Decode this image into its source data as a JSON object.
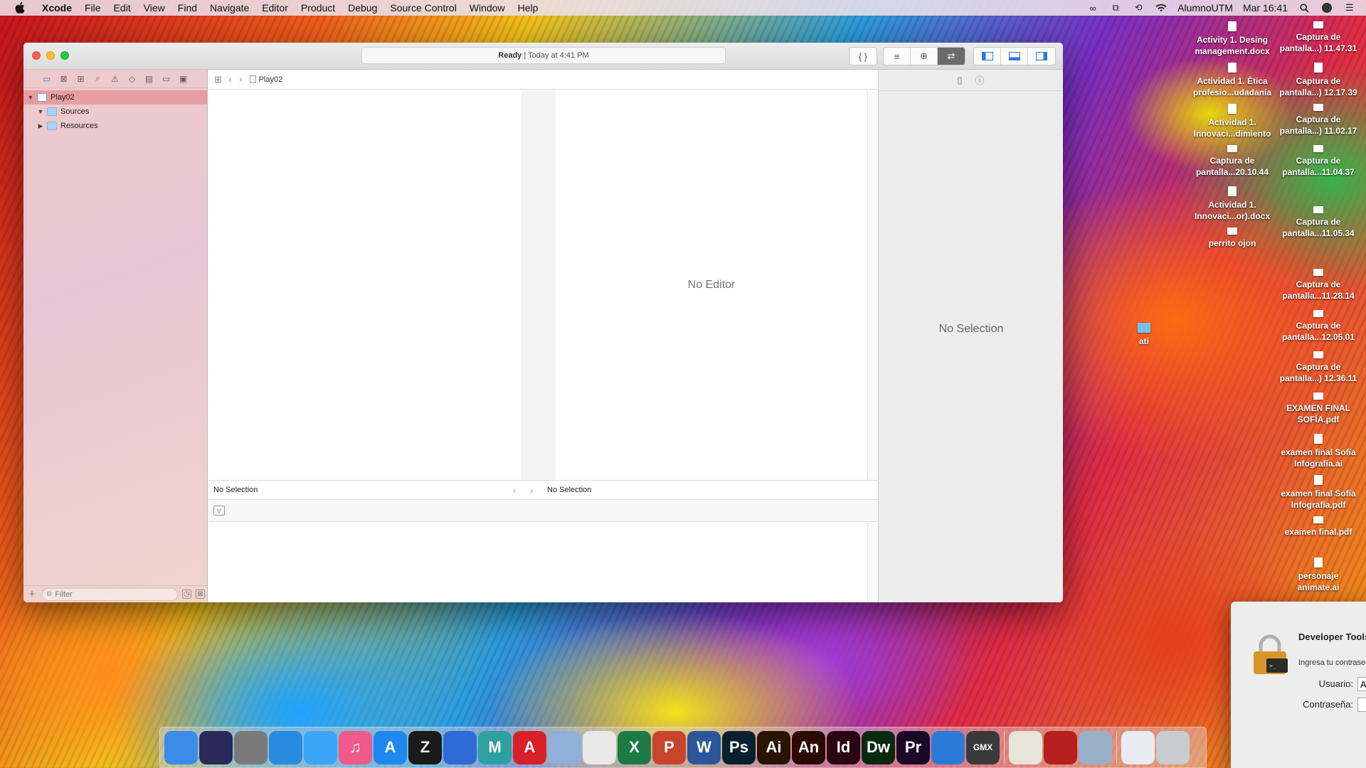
{
  "menubar": {
    "items": [
      "Xcode",
      "File",
      "Edit",
      "View",
      "Find",
      "Navigate",
      "Editor",
      "Product",
      "Debug",
      "Source Control",
      "Window",
      "Help"
    ],
    "user": "AlumnoUTM",
    "clock": "Mar 16:41"
  },
  "window": {
    "activity_status": "Ready",
    "activity_time": "Today at 4:41 PM",
    "toolbar": {
      "editor_buttons": [
        "{ }",
        "≡",
        "⊕",
        "⇄"
      ],
      "view_buttons": [
        "navigator-toggle",
        "debug-toggle",
        "inspector-toggle"
      ]
    },
    "navigator": {
      "items": [
        {
          "label": "Play02",
          "type": "doc",
          "level": 0,
          "expanded": true,
          "selected": true
        },
        {
          "label": "Sources",
          "type": "folder",
          "level": 1,
          "expanded": true,
          "selected": false
        },
        {
          "label": "Resources",
          "type": "folder",
          "level": 1,
          "expanded": false,
          "selected": false
        }
      ],
      "filter_placeholder": "Filter"
    },
    "jumpbar": {
      "crumb": "Play02"
    },
    "editor": {
      "empty_text": "No Editor"
    },
    "footer": {
      "left": "No Selection",
      "right": "No Selection"
    },
    "inspector": {
      "empty_text": "No Selection"
    }
  },
  "desktop": {
    "items": [
      "Activity 1. Desing management.docx",
      "Captura de pantalla...) 11.47.31",
      "Actividad 1. Ética profesio...udadanía",
      "Captura de pantalla...) 12.17.39",
      "Actividad 1. Innovaci...dimiento",
      "Captura de pantalla...) 11.02.17",
      "Captura de pantalla...20.10.44",
      "Captura de pantalla...11.04.37",
      "Actividad 1. Innovaci...or).docx",
      "Captura de pantalla...11.05.34",
      "perrito ojon",
      "Captura de pantalla...11.28.14",
      "ati",
      "Captura de pantalla...12.05.01",
      "Captura de pantalla...) 12.36.11",
      "EXAMEN FINAL SOFÍA.pdf",
      "examen final Sofía Infografía.ai",
      "examen final Sofía Infografía.pdf",
      "examen final.pdf",
      "personaje animate.ai"
    ]
  },
  "auth_dialog": {
    "title": "Developer Tools Access necesita el control de otro proceso",
    "subtitle": "Ingresa tu contraseña para permitirlo.",
    "user_label": "Usuario:",
    "user_value": "A",
    "password_label": "Contraseña:"
  },
  "dock": {
    "apps": [
      {
        "name": "Finder",
        "label": "",
        "color": "#3b8be8"
      },
      {
        "name": "Siri",
        "label": "",
        "color": "#2a2a5a"
      },
      {
        "name": "Launchpad",
        "label": "",
        "color": "#7a7a7a"
      },
      {
        "name": "Safari",
        "label": "",
        "color": "#2a8ae0"
      },
      {
        "name": "Messages",
        "label": "",
        "color": "#3aa6f5"
      },
      {
        "name": "iTunes",
        "label": "♫",
        "color": "#f05a8a"
      },
      {
        "name": "App Store",
        "label": "A",
        "color": "#1e88f0"
      },
      {
        "name": "Final Draft",
        "label": "Z",
        "color": "#1a1a1a"
      },
      {
        "name": "Network Radar",
        "label": "",
        "color": "#2e6ad8"
      },
      {
        "name": "Maya",
        "label": "M",
        "color": "#2ea0a0"
      },
      {
        "name": "Acrobat",
        "label": "A",
        "color": "#d8202a"
      },
      {
        "name": "Cube",
        "label": "",
        "color": "#8fb0d8"
      },
      {
        "name": "Chrome",
        "label": "",
        "color": "#e8e8e8"
      },
      {
        "name": "Excel",
        "label": "X",
        "color": "#1d7a45"
      },
      {
        "name": "PowerPoint",
        "label": "P",
        "color": "#c8452b"
      },
      {
        "name": "Word",
        "label": "W",
        "color": "#2b579a"
      },
      {
        "name": "Photoshop",
        "label": "Ps",
        "color": "#0a1f30"
      },
      {
        "name": "Illustrator",
        "label": "Ai",
        "color": "#2a1300"
      },
      {
        "name": "Animate",
        "label": "An",
        "color": "#2a0a00"
      },
      {
        "name": "InDesign",
        "label": "Id",
        "color": "#2a0512"
      },
      {
        "name": "Dreamweaver",
        "label": "Dw",
        "color": "#0a2a10"
      },
      {
        "name": "Premiere",
        "label": "Pr",
        "color": "#1a0828"
      },
      {
        "name": "Xcode",
        "label": "",
        "color": "#2a7ad8"
      },
      {
        "name": "GameMaker",
        "label": "GMX",
        "color": "#3a3a3a"
      },
      {
        "name": "TextEdit",
        "label": "",
        "color": "#e8e4d8"
      },
      {
        "name": "Acrobat Reader",
        "label": "",
        "color": "#b81e1e"
      },
      {
        "name": "Preview",
        "label": "",
        "color": "#9ab0c8"
      },
      {
        "name": "Downloads",
        "label": "",
        "color": "#e8ecf0"
      },
      {
        "name": "Trash",
        "label": "",
        "color": "#c8ccd0"
      }
    ]
  }
}
